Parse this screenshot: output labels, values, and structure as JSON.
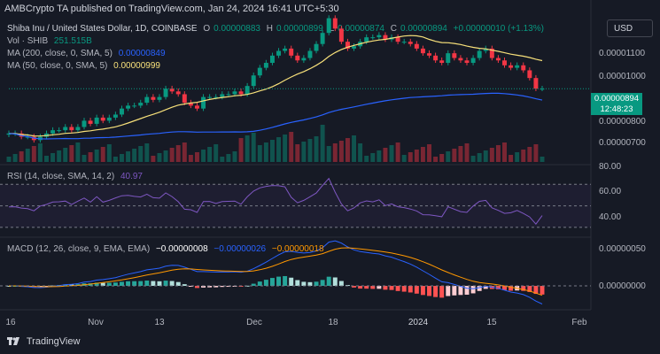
{
  "header": "AMBCrypto  TA published on TradingView.com, Jan 24, 2024 16:41 UTC+5:30",
  "currency_button": "USD",
  "legend": {
    "symbol": "Shiba Inu / United States Dollar, 1D, COINBASE",
    "ohlc": [
      {
        "label": "O",
        "value": "0.00000883"
      },
      {
        "label": "H",
        "value": "0.00000899"
      },
      {
        "label": "L",
        "value": "0.00000874"
      },
      {
        "label": "C",
        "value": "0.00000894"
      }
    ],
    "change": "+0.00000010 (+1.13%)",
    "vol_label": "Vol · SHIB",
    "vol_value": "251.515B",
    "ma200_label": "MA (200, close, 0, SMA, 5)",
    "ma200_value": "0.00000849",
    "ma50_label": "MA (50, close, 0, SMA, 5)",
    "ma50_value": "0.00000999",
    "rsi_label": "RSI (14, close, SMA, 14, 2)",
    "rsi_value": "40.97",
    "macd_label": "MACD (12, 26, close, 9, EMA, EMA)",
    "macd_hist": "−0.00000008",
    "macd_line": "−0.00000026",
    "macd_signal": "−0.00000018"
  },
  "price_box": {
    "price": "0.00000894",
    "countdown": "12:48:23"
  },
  "brand": "TradingView",
  "colors": {
    "bg": "#161a25",
    "up": "#089981",
    "down": "#f23645",
    "ma200": "#2962ff",
    "ma50": "#f7e07a",
    "rsi": "#7e57c2",
    "macd": "#2962ff",
    "signal": "#ff9800"
  },
  "chart_data": [
    {
      "type": "candlestick",
      "title": "Shiba Inu / United States Dollar, 1D, COINBASE",
      "y_axis": {
        "scale": "log",
        "ticks": [
          "0.00001100",
          "0.00001000",
          "0.00000900",
          "0.00000800",
          "0.00000700"
        ]
      },
      "x_axis": {
        "ticks": [
          "16",
          "Nov",
          "13",
          "Dec",
          "18",
          "2024",
          "15",
          "Feb"
        ]
      },
      "close_series": [
        7.4e-06,
        7.4e-06,
        7.3e-06,
        7.3e-06,
        7.2e-06,
        7.3e-06,
        7.4e-06,
        7.5e-06,
        7.5e-06,
        7.6e-06,
        7.5e-06,
        7.6e-06,
        7.8e-06,
        7.7e-06,
        7.9e-06,
        7.8e-06,
        7.9e-06,
        8e-06,
        8.2e-06,
        8.3e-06,
        8.3e-06,
        8.4e-06,
        8.6e-06,
        8.5e-06,
        8.6e-06,
        8.9e-06,
        8.8e-06,
        8.7e-06,
        8.4e-06,
        8.3e-06,
        8.2e-06,
        8.6e-06,
        8.6e-06,
        8.6e-06,
        8.7e-06,
        8.7e-06,
        8.8e-06,
        8.7e-06,
        9e-06,
        9.4e-06,
        9.7e-06,
        9.9e-06,
        1.02e-05,
        1.04e-05,
        1.05e-05,
        1.02e-05,
        1e-05,
        1.01e-05,
        1.04e-05,
        1.07e-05,
        1.12e-05,
        1.19e-05,
        1.14e-05,
        1.08e-05,
        1.05e-05,
        1.06e-05,
        1.08e-05,
        1.1e-05,
        1.1e-05,
        1.11e-05,
        1.09e-05,
        1.1e-05,
        1.08e-05,
        1.08e-05,
        1.07e-05,
        1.05e-05,
        1.03e-05,
        1.02e-05,
        1e-05,
        9.9e-06,
        1.03e-05,
        1.01e-05,
        1e-05,
        9.9e-06,
        1.01e-05,
        1.04e-05,
        1.05e-05,
        1.01e-05,
        1e-05,
        9.8e-06,
        9.7e-06,
        9.8e-06,
        9.6e-06,
        9.3e-06,
        8.9e-06,
        8.9e-06
      ],
      "ma50_last": 9.99e-06,
      "ma200_last": 8.49e-06
    },
    {
      "type": "bar",
      "title": "Vol · SHIB",
      "last_value": "251.515B"
    },
    {
      "type": "line",
      "title": "RSI (14, close, SMA, 14, 2)",
      "y_axis": {
        "ticks": [
          "80.00",
          "60.00",
          "40.00"
        ]
      },
      "bands": [
        70,
        50,
        30
      ],
      "last_value": 40.97
    },
    {
      "type": "bar",
      "title": "MACD (12, 26, close, 9, EMA, EMA)",
      "y_axis": {
        "ticks": [
          "0.00000050",
          "0.00000000"
        ]
      },
      "histogram_last": -8e-08,
      "macd_last": -2.6e-07,
      "signal_last": -1.8e-07
    }
  ]
}
